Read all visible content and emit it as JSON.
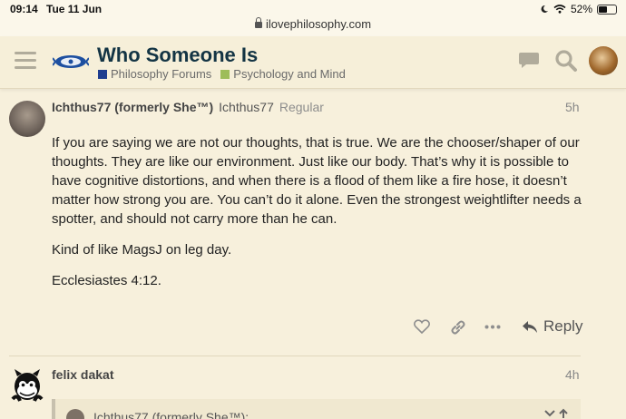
{
  "status_bar": {
    "time": "09:14",
    "date": "Tue 11 Jun",
    "battery_percent": "52%",
    "battery_level": 0.52
  },
  "browser": {
    "url": "ilovephilosophy.com"
  },
  "header": {
    "title": "Who Someone Is",
    "breadcrumbs": [
      {
        "label": "Philosophy Forums",
        "color": "#1e3d8f"
      },
      {
        "label": "Psychology and Mind",
        "color": "#9ebd5a"
      }
    ]
  },
  "post1": {
    "author_display": "Ichthus77 (formerly She™)",
    "username": "Ichthus77",
    "user_title": "Regular",
    "time_ago": "5h",
    "paragraphs": [
      "If you are saying we are not our thoughts, that is true. We are the chooser/shaper of our thoughts. They are like our environment. Just like our body. That’s why it is possible to have cognitive distortions, and when there is a flood of them like a fire hose, it doesn’t matter how strong you are. You can’t do it alone. Even the strongest weightlifter needs a spotter, and should not carry more than he can.",
      "Kind of like MagsJ on leg day.",
      "Ecclesiastes 4:12."
    ],
    "reply_label": "Reply"
  },
  "post2": {
    "author": "felix dakat",
    "time_ago": "4h",
    "quote_author": "Ichthus77 (formerly She™):"
  }
}
